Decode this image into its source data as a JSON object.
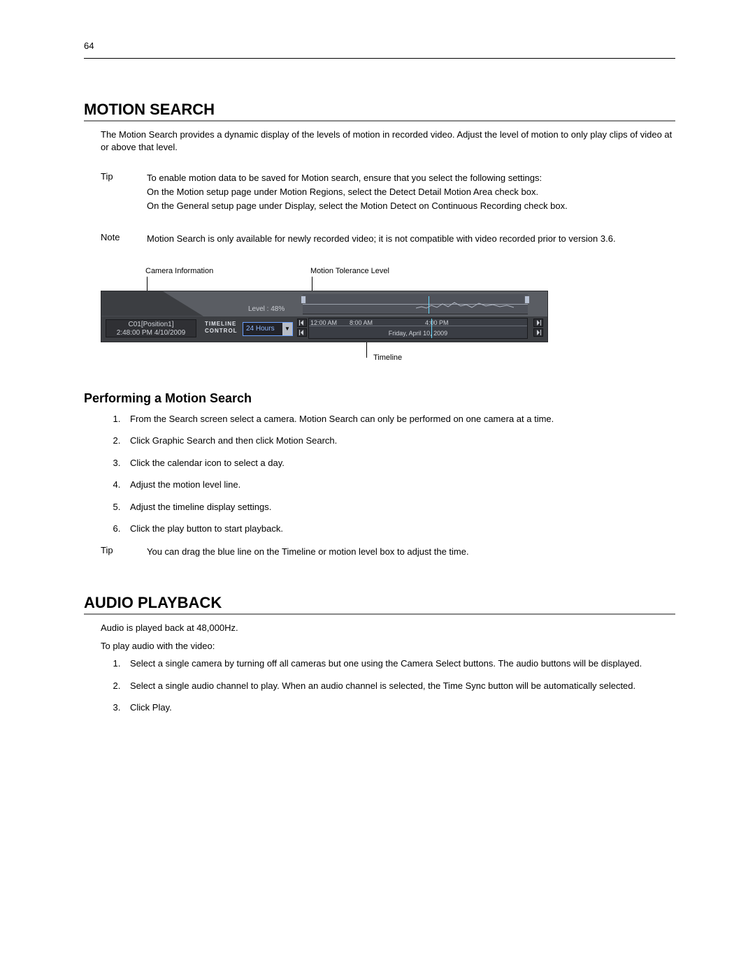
{
  "page_number": "64",
  "section1": {
    "title": "MOTION SEARCH",
    "intro": "The Motion Search provides a dynamic display of the levels of motion in recorded video.  Adjust the level of motion to only play clips of video at or above that level.",
    "tip_label": "Tip",
    "tip_line1_a": "To enable motion data to be saved for Motion search, ensure that you select the following settings:",
    "tip_line2_a": "On the ",
    "tip_line2_b": "Motion",
    "tip_line2_c": " setup page under ",
    "tip_line2_d": "Motion Regions",
    "tip_line2_e": ", select the ",
    "tip_line2_f": "Detect Detail Motion Area",
    "tip_line2_g": " check box.",
    "tip_line3_a": "On the ",
    "tip_line3_b": "General",
    "tip_line3_c": " setup page under ",
    "tip_line3_d": "Display",
    "tip_line3_e": ", select the ",
    "tip_line3_f": "Motion Detect on Continuous Recording",
    "tip_line3_g": " check box.",
    "note_label": "Note",
    "note_text": "Motion Search is only available for newly recorded video; it is not compatible with video recorded prior to version 3.6."
  },
  "figure": {
    "callout_camera": "Camera Information",
    "callout_motion": "Motion Tolerance Level",
    "callout_timeline": "Timeline",
    "cam_line1": "C01[Position1]",
    "cam_line2": "2:48:00 PM  4/10/2009",
    "tl_control_l1": "TIMELINE",
    "tl_control_l2": "CONTROL",
    "hours": "24 Hours",
    "level_text": "Level :  48%",
    "t1": "12:00 AM",
    "t2": "8:00 AM",
    "t3": "4:00 PM",
    "date": "Friday, April 10, 2009"
  },
  "subsection": {
    "title": "Performing a Motion Search",
    "step1_a": "From the ",
    "step1_b": "Search",
    "step1_c": " screen select a camera.  Motion Search can only be performed on one camera at a time.",
    "step2_a": "Click ",
    "step2_b": "Graphic Search",
    "step2_c": " and then click ",
    "step2_d": "Motion Search",
    "step2_e": ".",
    "step3": "Click the calendar icon to select a day.",
    "step4": "Adjust the motion level line.",
    "step5": "Adjust the timeline display settings.",
    "step6": "Click the play button to start playback.",
    "tip_label": "Tip",
    "tip_text": "You can drag the blue line on the Timeline or motion level box to adjust the time."
  },
  "section2": {
    "title": "AUDIO PLAYBACK",
    "line1": "Audio is played back at 48,000Hz.",
    "line2": "To play audio with the video:",
    "step1": "Select a single camera by turning off all cameras but one using the Camera Select buttons.  The audio buttons will be displayed.",
    "step2": "Select a single audio channel to play.  When an audio channel is selected, the Time Sync button will be automatically selected.",
    "step3": "Click Play."
  }
}
